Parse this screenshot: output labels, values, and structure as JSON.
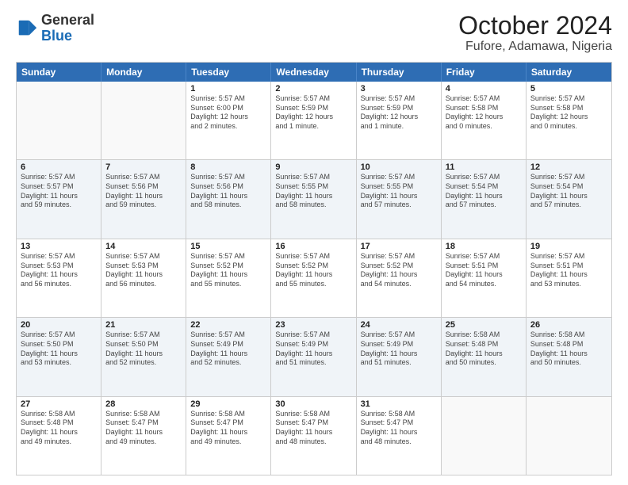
{
  "header": {
    "logo_general": "General",
    "logo_blue": "Blue",
    "month_title": "October 2024",
    "location": "Fufore, Adamawa, Nigeria"
  },
  "weekdays": [
    "Sunday",
    "Monday",
    "Tuesday",
    "Wednesday",
    "Thursday",
    "Friday",
    "Saturday"
  ],
  "rows": [
    [
      {
        "day": "",
        "lines": [],
        "empty": true
      },
      {
        "day": "",
        "lines": [],
        "empty": true
      },
      {
        "day": "1",
        "lines": [
          "Sunrise: 5:57 AM",
          "Sunset: 6:00 PM",
          "Daylight: 12 hours",
          "and 2 minutes."
        ]
      },
      {
        "day": "2",
        "lines": [
          "Sunrise: 5:57 AM",
          "Sunset: 5:59 PM",
          "Daylight: 12 hours",
          "and 1 minute."
        ]
      },
      {
        "day": "3",
        "lines": [
          "Sunrise: 5:57 AM",
          "Sunset: 5:59 PM",
          "Daylight: 12 hours",
          "and 1 minute."
        ]
      },
      {
        "day": "4",
        "lines": [
          "Sunrise: 5:57 AM",
          "Sunset: 5:58 PM",
          "Daylight: 12 hours",
          "and 0 minutes."
        ]
      },
      {
        "day": "5",
        "lines": [
          "Sunrise: 5:57 AM",
          "Sunset: 5:58 PM",
          "Daylight: 12 hours",
          "and 0 minutes."
        ]
      }
    ],
    [
      {
        "day": "6",
        "lines": [
          "Sunrise: 5:57 AM",
          "Sunset: 5:57 PM",
          "Daylight: 11 hours",
          "and 59 minutes."
        ]
      },
      {
        "day": "7",
        "lines": [
          "Sunrise: 5:57 AM",
          "Sunset: 5:56 PM",
          "Daylight: 11 hours",
          "and 59 minutes."
        ]
      },
      {
        "day": "8",
        "lines": [
          "Sunrise: 5:57 AM",
          "Sunset: 5:56 PM",
          "Daylight: 11 hours",
          "and 58 minutes."
        ]
      },
      {
        "day": "9",
        "lines": [
          "Sunrise: 5:57 AM",
          "Sunset: 5:55 PM",
          "Daylight: 11 hours",
          "and 58 minutes."
        ]
      },
      {
        "day": "10",
        "lines": [
          "Sunrise: 5:57 AM",
          "Sunset: 5:55 PM",
          "Daylight: 11 hours",
          "and 57 minutes."
        ]
      },
      {
        "day": "11",
        "lines": [
          "Sunrise: 5:57 AM",
          "Sunset: 5:54 PM",
          "Daylight: 11 hours",
          "and 57 minutes."
        ]
      },
      {
        "day": "12",
        "lines": [
          "Sunrise: 5:57 AM",
          "Sunset: 5:54 PM",
          "Daylight: 11 hours",
          "and 57 minutes."
        ]
      }
    ],
    [
      {
        "day": "13",
        "lines": [
          "Sunrise: 5:57 AM",
          "Sunset: 5:53 PM",
          "Daylight: 11 hours",
          "and 56 minutes."
        ]
      },
      {
        "day": "14",
        "lines": [
          "Sunrise: 5:57 AM",
          "Sunset: 5:53 PM",
          "Daylight: 11 hours",
          "and 56 minutes."
        ]
      },
      {
        "day": "15",
        "lines": [
          "Sunrise: 5:57 AM",
          "Sunset: 5:52 PM",
          "Daylight: 11 hours",
          "and 55 minutes."
        ]
      },
      {
        "day": "16",
        "lines": [
          "Sunrise: 5:57 AM",
          "Sunset: 5:52 PM",
          "Daylight: 11 hours",
          "and 55 minutes."
        ]
      },
      {
        "day": "17",
        "lines": [
          "Sunrise: 5:57 AM",
          "Sunset: 5:52 PM",
          "Daylight: 11 hours",
          "and 54 minutes."
        ]
      },
      {
        "day": "18",
        "lines": [
          "Sunrise: 5:57 AM",
          "Sunset: 5:51 PM",
          "Daylight: 11 hours",
          "and 54 minutes."
        ]
      },
      {
        "day": "19",
        "lines": [
          "Sunrise: 5:57 AM",
          "Sunset: 5:51 PM",
          "Daylight: 11 hours",
          "and 53 minutes."
        ]
      }
    ],
    [
      {
        "day": "20",
        "lines": [
          "Sunrise: 5:57 AM",
          "Sunset: 5:50 PM",
          "Daylight: 11 hours",
          "and 53 minutes."
        ]
      },
      {
        "day": "21",
        "lines": [
          "Sunrise: 5:57 AM",
          "Sunset: 5:50 PM",
          "Daylight: 11 hours",
          "and 52 minutes."
        ]
      },
      {
        "day": "22",
        "lines": [
          "Sunrise: 5:57 AM",
          "Sunset: 5:49 PM",
          "Daylight: 11 hours",
          "and 52 minutes."
        ]
      },
      {
        "day": "23",
        "lines": [
          "Sunrise: 5:57 AM",
          "Sunset: 5:49 PM",
          "Daylight: 11 hours",
          "and 51 minutes."
        ]
      },
      {
        "day": "24",
        "lines": [
          "Sunrise: 5:57 AM",
          "Sunset: 5:49 PM",
          "Daylight: 11 hours",
          "and 51 minutes."
        ]
      },
      {
        "day": "25",
        "lines": [
          "Sunrise: 5:58 AM",
          "Sunset: 5:48 PM",
          "Daylight: 11 hours",
          "and 50 minutes."
        ]
      },
      {
        "day": "26",
        "lines": [
          "Sunrise: 5:58 AM",
          "Sunset: 5:48 PM",
          "Daylight: 11 hours",
          "and 50 minutes."
        ]
      }
    ],
    [
      {
        "day": "27",
        "lines": [
          "Sunrise: 5:58 AM",
          "Sunset: 5:48 PM",
          "Daylight: 11 hours",
          "and 49 minutes."
        ]
      },
      {
        "day": "28",
        "lines": [
          "Sunrise: 5:58 AM",
          "Sunset: 5:47 PM",
          "Daylight: 11 hours",
          "and 49 minutes."
        ]
      },
      {
        "day": "29",
        "lines": [
          "Sunrise: 5:58 AM",
          "Sunset: 5:47 PM",
          "Daylight: 11 hours",
          "and 49 minutes."
        ]
      },
      {
        "day": "30",
        "lines": [
          "Sunrise: 5:58 AM",
          "Sunset: 5:47 PM",
          "Daylight: 11 hours",
          "and 48 minutes."
        ]
      },
      {
        "day": "31",
        "lines": [
          "Sunrise: 5:58 AM",
          "Sunset: 5:47 PM",
          "Daylight: 11 hours",
          "and 48 minutes."
        ]
      },
      {
        "day": "",
        "lines": [],
        "empty": true
      },
      {
        "day": "",
        "lines": [],
        "empty": true
      }
    ]
  ]
}
